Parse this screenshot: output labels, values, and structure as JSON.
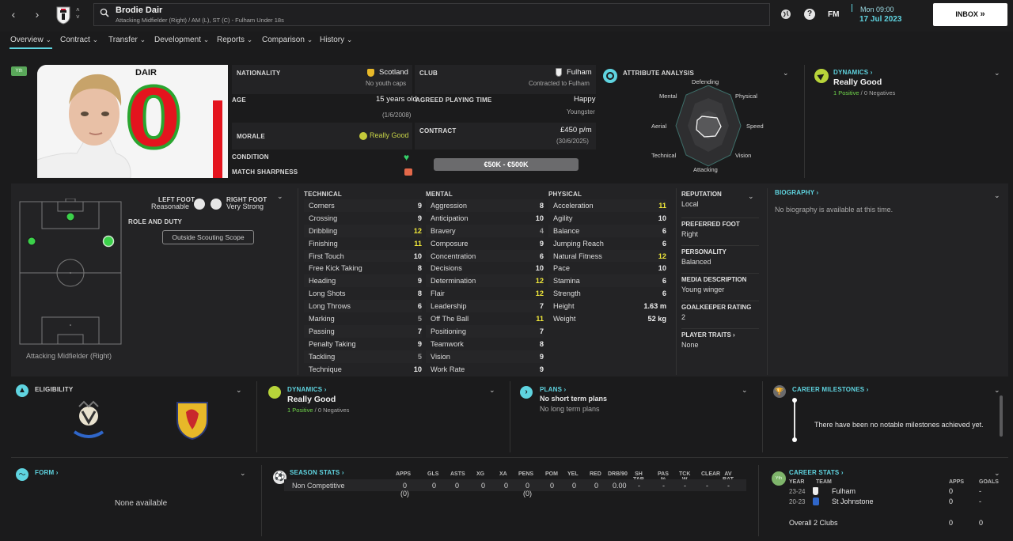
{
  "header": {
    "player_name": "Brodie Dair",
    "subtitle": "Attacking Midfielder (Right) / AM (L), ST (C) - Fulham Under 18s",
    "day_time": "Mon 09:00",
    "date": "17 Jul 2023",
    "fm_label": "FM",
    "inbox_label": "INBOX"
  },
  "tabs": [
    "Overview",
    "Contract",
    "Transfer",
    "Development",
    "Reports",
    "Comparison",
    "History"
  ],
  "profile": {
    "youth_badge": "Yth",
    "shirt_name": "DAIR",
    "shirt_number": "0",
    "nationality_label": "NATIONALITY",
    "nationality": "Scotland",
    "youth_caps": "No youth caps",
    "age_label": "AGE",
    "age": "15 years old",
    "dob": "(1/6/2008)",
    "morale_label": "MORALE",
    "morale": "Really Good",
    "condition_label": "CONDITION",
    "sharpness_label": "MATCH SHARPNESS",
    "club_label": "CLUB",
    "club": "Fulham",
    "club_status": "Contracted to Fulham",
    "playing_time_label": "AGREED PLAYING TIME",
    "playing_time_mood": "Happy",
    "playing_time": "Youngster",
    "contract_label": "CONTRACT",
    "wage": "£450 p/m",
    "contract_end": "(30/6/2025)",
    "value_range": "€50K - €500K"
  },
  "attribute_analysis": {
    "title": "ATTRIBUTE ANALYSIS",
    "labels": [
      "Defending",
      "Physical",
      "Speed",
      "Vision",
      "Attacking",
      "Technical",
      "Aerial",
      "Mental"
    ]
  },
  "dynamics": {
    "title": "DYNAMICS",
    "value": "Really Good",
    "positives": "1 Positive",
    "negatives": "0 Negatives"
  },
  "pitch": {
    "position_label": "Attacking Midfielder (Right)",
    "left_foot_label": "LEFT FOOT",
    "left_foot": "Reasonable",
    "right_foot_label": "RIGHT FOOT",
    "right_foot": "Very Strong",
    "role_label": "ROLE AND DUTY",
    "scouting_button": "Outside Scouting Scope"
  },
  "attributes": {
    "technical_title": "TECHNICAL",
    "mental_title": "MENTAL",
    "physical_title": "PHYSICAL",
    "technical": [
      {
        "name": "Corners",
        "value": "9"
      },
      {
        "name": "Crossing",
        "value": "9"
      },
      {
        "name": "Dribbling",
        "value": "12"
      },
      {
        "name": "Finishing",
        "value": "11"
      },
      {
        "name": "First Touch",
        "value": "10"
      },
      {
        "name": "Free Kick Taking",
        "value": "8"
      },
      {
        "name": "Heading",
        "value": "9"
      },
      {
        "name": "Long Shots",
        "value": "8"
      },
      {
        "name": "Long Throws",
        "value": "6"
      },
      {
        "name": "Marking",
        "value": "5"
      },
      {
        "name": "Passing",
        "value": "7"
      },
      {
        "name": "Penalty Taking",
        "value": "9"
      },
      {
        "name": "Tackling",
        "value": "5"
      },
      {
        "name": "Technique",
        "value": "10"
      }
    ],
    "mental": [
      {
        "name": "Aggression",
        "value": "8"
      },
      {
        "name": "Anticipation",
        "value": "10"
      },
      {
        "name": "Bravery",
        "value": "4"
      },
      {
        "name": "Composure",
        "value": "9"
      },
      {
        "name": "Concentration",
        "value": "6"
      },
      {
        "name": "Decisions",
        "value": "10"
      },
      {
        "name": "Determination",
        "value": "12"
      },
      {
        "name": "Flair",
        "value": "12"
      },
      {
        "name": "Leadership",
        "value": "7"
      },
      {
        "name": "Off The Ball",
        "value": "11"
      },
      {
        "name": "Positioning",
        "value": "7"
      },
      {
        "name": "Teamwork",
        "value": "8"
      },
      {
        "name": "Vision",
        "value": "9"
      },
      {
        "name": "Work Rate",
        "value": "9"
      }
    ],
    "physical": [
      {
        "name": "Acceleration",
        "value": "11"
      },
      {
        "name": "Agility",
        "value": "10"
      },
      {
        "name": "Balance",
        "value": "6"
      },
      {
        "name": "Jumping Reach",
        "value": "6"
      },
      {
        "name": "Natural Fitness",
        "value": "12"
      },
      {
        "name": "Pace",
        "value": "10"
      },
      {
        "name": "Stamina",
        "value": "6"
      },
      {
        "name": "Strength",
        "value": "6"
      }
    ],
    "height_label": "Height",
    "height": "1.63 m",
    "weight_label": "Weight",
    "weight": "52 kg"
  },
  "info": {
    "reputation_label": "REPUTATION",
    "reputation": "Local",
    "preferred_foot_label": "PREFERRED FOOT",
    "preferred_foot": "Right",
    "personality_label": "PERSONALITY",
    "personality": "Balanced",
    "media_label": "MEDIA DESCRIPTION",
    "media": "Young winger",
    "gk_label": "GOALKEEPER RATING",
    "gk": "2",
    "traits_label": "PLAYER TRAITS",
    "traits": "None"
  },
  "biography": {
    "title": "BIOGRAPHY",
    "text": "No biography is available at this time."
  },
  "eligibility": {
    "title": "ELIGIBILITY"
  },
  "plans": {
    "title": "PLANS",
    "short": "No short term plans",
    "long": "No long term plans"
  },
  "milestones": {
    "title": "CAREER MILESTONES",
    "text": "There have been no notable milestones achieved yet."
  },
  "form": {
    "title": "FORM",
    "empty": "None available"
  },
  "season_stats": {
    "title": "SEASON STATS",
    "headers": [
      "APPS",
      "GLS",
      "ASTS",
      "XG",
      "XA",
      "PENS",
      "POM",
      "YEL",
      "RED",
      "DRB/90",
      "SH TAR",
      "PAS %",
      "TCK W",
      "CLEAR",
      "AV RAT"
    ],
    "row_label": "Non Competitive",
    "row": [
      "0 (0)",
      "0",
      "0",
      "0",
      "0",
      "0 (0)",
      "0",
      "0",
      "0",
      "0.00",
      "-",
      "-",
      "-",
      "-",
      "-"
    ]
  },
  "career_stats": {
    "title": "CAREER STATS",
    "year_header": "YEAR",
    "team_header": "TEAM",
    "apps_header": "APPS",
    "goals_header": "GOALS",
    "rows": [
      {
        "year": "23-24",
        "team": "Fulham",
        "apps": "0",
        "goals": "-"
      },
      {
        "year": "20-23",
        "team": "St Johnstone",
        "apps": "0",
        "goals": "-"
      }
    ],
    "overall_label": "Overall",
    "overall_clubs": "2 Clubs",
    "overall_apps": "0",
    "overall_goals": "0"
  },
  "colors": {
    "accent": "#5fd4e0",
    "positive": "#6fd44a",
    "highlight": "#f0e83a",
    "background": "#1b1b1c"
  }
}
